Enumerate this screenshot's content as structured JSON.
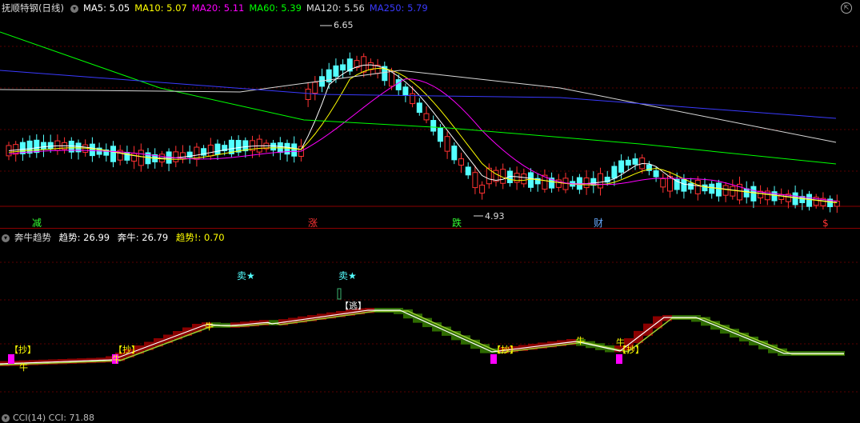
{
  "main_panel": {
    "title": "抚顺特钢(日线)",
    "ma": [
      {
        "label": "MA5: 5.05",
        "color": "#ffffff"
      },
      {
        "label": "MA10: 5.07",
        "color": "#ffff00"
      },
      {
        "label": "MA20: 5.11",
        "color": "#ff00ff"
      },
      {
        "label": "MA60: 5.39",
        "color": "#00ff00"
      },
      {
        "label": "MA120: 5.56",
        "color": "#d8d8d8"
      },
      {
        "label": "MA250: 5.79",
        "color": "#3a3aff"
      }
    ],
    "high_label": "6.65",
    "low_label": "4.93",
    "bottom_marks": [
      {
        "text": "减",
        "color": "#33ff33"
      },
      {
        "text": "涨",
        "color": "#ff3333"
      },
      {
        "text": "跌",
        "color": "#33ff33"
      },
      {
        "text": "财",
        "color": "#66aaff"
      },
      {
        "text": "$",
        "color": "#ff3333"
      }
    ]
  },
  "indicator_panel": {
    "title": "奔牛趋势",
    "values": [
      {
        "label": "趋势: 26.99",
        "color": "#ffffff"
      },
      {
        "label": "奔牛: 26.79",
        "color": "#ffffff"
      },
      {
        "label": "趋势!: 0.70",
        "color": "#ffff00"
      }
    ],
    "sell_labels": [
      "卖★",
      "卖★"
    ],
    "escape_label": "【逃】",
    "buy_label": "【抄】",
    "bull_label": "牛"
  },
  "cci_row": {
    "label": "CCI(14)  CCI: 71.88"
  },
  "colors": {
    "up": "#ff3232",
    "down": "#54ffff",
    "ma5": "#ffffff",
    "ma10": "#ffff00",
    "ma20": "#ff00ff",
    "ma60": "#00ff00",
    "ma120": "#d8d8d8",
    "ma250": "#3a3aff",
    "band_up": "#8b0000",
    "band_down": "#2e6b00"
  }
}
